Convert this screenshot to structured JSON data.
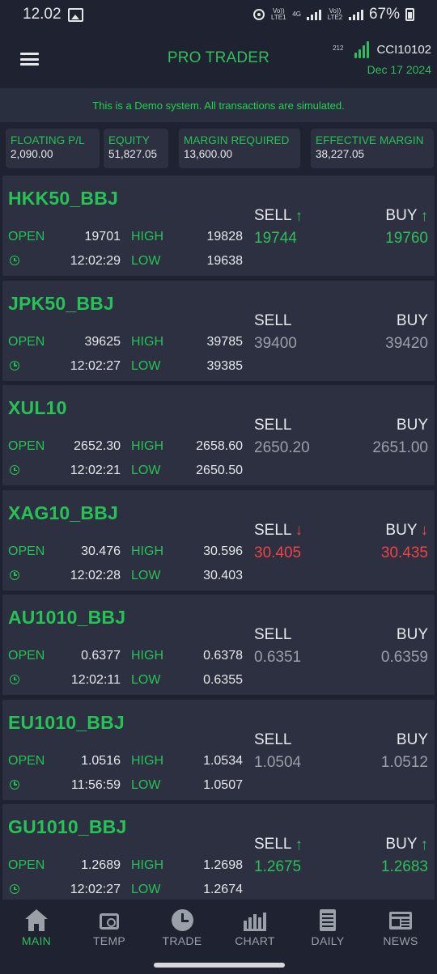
{
  "status_bar": {
    "time": "12.02",
    "battery": "67%",
    "net1": "Vo)) LTE1",
    "net2": "4G",
    "net3": "Vo)) LTE2"
  },
  "header": {
    "title": "PRO TRADER",
    "ping": "212",
    "account": "CCI10102",
    "date": "Dec 17 2024"
  },
  "banner": "This is a Demo system. All transactions are simulated.",
  "summary": [
    {
      "label": "FLOATING P/L",
      "value": "2,090.00"
    },
    {
      "label": "EQUITY",
      "value": "51,827.05"
    },
    {
      "label": "MARGIN REQUIRED",
      "value": "13,600.00"
    },
    {
      "label": "EFFECTIVE MARGIN",
      "value": "38,227.05"
    }
  ],
  "quote_labels": {
    "open": "OPEN",
    "high": "HIGH",
    "low": "LOW",
    "sell": "SELL",
    "buy": "BUY"
  },
  "quotes": [
    {
      "symbol": "HKK50_BBJ",
      "open": "19701",
      "high": "19828",
      "time": "12:02:29",
      "low": "19638",
      "sell": "19744",
      "buy": "19760",
      "trend": "up"
    },
    {
      "symbol": "JPK50_BBJ",
      "open": "39625",
      "high": "39785",
      "time": "12:02:27",
      "low": "39385",
      "sell": "39400",
      "buy": "39420",
      "trend": "flat"
    },
    {
      "symbol": "XUL10",
      "open": "2652.30",
      "high": "2658.60",
      "time": "12:02:21",
      "low": "2650.50",
      "sell": "2650.20",
      "buy": "2651.00",
      "trend": "flat"
    },
    {
      "symbol": "XAG10_BBJ",
      "open": "30.476",
      "high": "30.596",
      "time": "12:02:28",
      "low": "30.403",
      "sell": "30.405",
      "buy": "30.435",
      "trend": "down"
    },
    {
      "symbol": "AU1010_BBJ",
      "open": "0.6377",
      "high": "0.6378",
      "time": "12:02:11",
      "low": "0.6355",
      "sell": "0.6351",
      "buy": "0.6359",
      "trend": "flat"
    },
    {
      "symbol": "EU1010_BBJ",
      "open": "1.0516",
      "high": "1.0534",
      "time": "11:56:59",
      "low": "1.0507",
      "sell": "1.0504",
      "buy": "1.0512",
      "trend": "flat"
    },
    {
      "symbol": "GU1010_BBJ",
      "open": "1.2689",
      "high": "1.2698",
      "time": "12:02:27",
      "low": "1.2674",
      "sell": "1.2675",
      "buy": "1.2683",
      "trend": "up"
    }
  ],
  "nav": [
    {
      "label": "MAIN",
      "icon": "home-icon",
      "active": true
    },
    {
      "label": "TEMP",
      "icon": "temp-icon",
      "active": false
    },
    {
      "label": "TRADE",
      "icon": "clock-icon",
      "active": false
    },
    {
      "label": "CHART",
      "icon": "chart-icon",
      "active": false
    },
    {
      "label": "DAILY",
      "icon": "daily-icon",
      "active": false
    },
    {
      "label": "NEWS",
      "icon": "news-icon",
      "active": false
    }
  ],
  "colors": {
    "accent": "#2fbf5a",
    "up": "#2fbf5a",
    "down": "#ef4444",
    "flat": "#9aa0a8",
    "card": "#2c3040",
    "background": "#1f2230"
  }
}
